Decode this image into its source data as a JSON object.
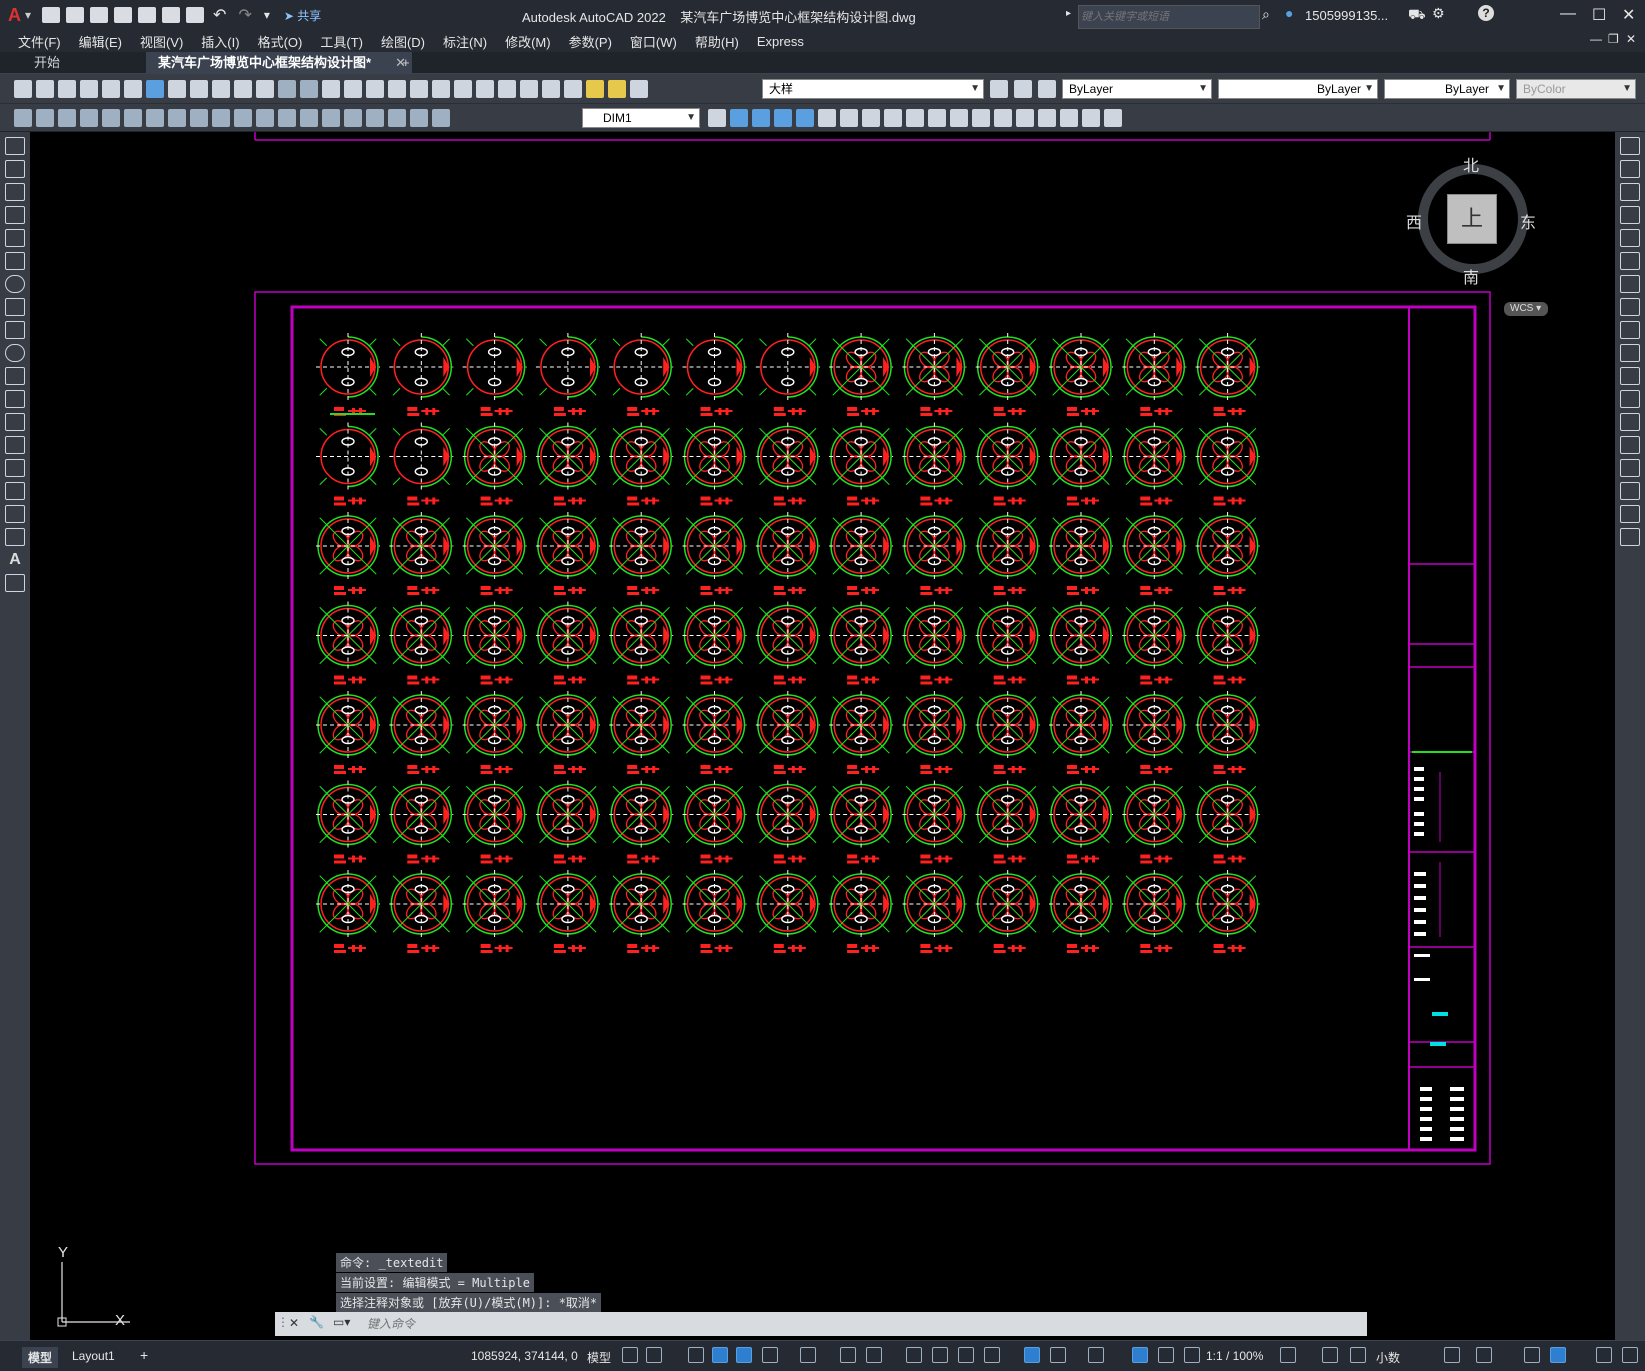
{
  "titlebar": {
    "app_letter": "A",
    "share_label": "共享",
    "window_title": "Autodesk AutoCAD 2022    某汽车广场博览中心框架结构设计图.dwg",
    "search_placeholder": "键入关键字或短语",
    "user": "1505999135...",
    "minimize": "—",
    "maximize": "☐",
    "close": "✕"
  },
  "menubar": {
    "items": [
      "文件(F)",
      "编辑(E)",
      "视图(V)",
      "插入(I)",
      "格式(O)",
      "工具(T)",
      "绘图(D)",
      "标注(N)",
      "修改(M)",
      "参数(P)",
      "窗口(W)",
      "帮助(H)",
      "Express"
    ]
  },
  "tabs": {
    "start": "开始",
    "drawing": "某汽车广场博览中心框架结构设计图*",
    "add": "+"
  },
  "toolbar": {
    "layer": "大样",
    "color": "ByLayer",
    "linetype": "ByLayer",
    "lineweight": "ByLayer",
    "plotstyle": "ByColor",
    "dimstyle": "DIM1"
  },
  "viewcube": {
    "north": "北",
    "south": "南",
    "east": "东",
    "west": "西",
    "top": "上",
    "wcs": "WCS"
  },
  "ucs": {
    "x": "X",
    "y": "Y"
  },
  "command": {
    "history": [
      "命令: _textedit",
      "当前设置: 编辑模式 = Multiple",
      "选择注释对象或 [放弃(U)/模式(M)]: *取消*"
    ],
    "placeholder": "键入命令"
  },
  "layout_tabs": [
    "模型",
    "Layout1"
  ],
  "status": {
    "coords": "1085924, 374144, 0",
    "mode": "模型",
    "scale": "1:1 / 100%",
    "units": "小数"
  },
  "colors": {
    "ui_dark": "#262b33",
    "toolbar": "#373c45",
    "frame": "#c000c0",
    "detail_red": "#ff2020",
    "detail_green": "#20e020"
  }
}
